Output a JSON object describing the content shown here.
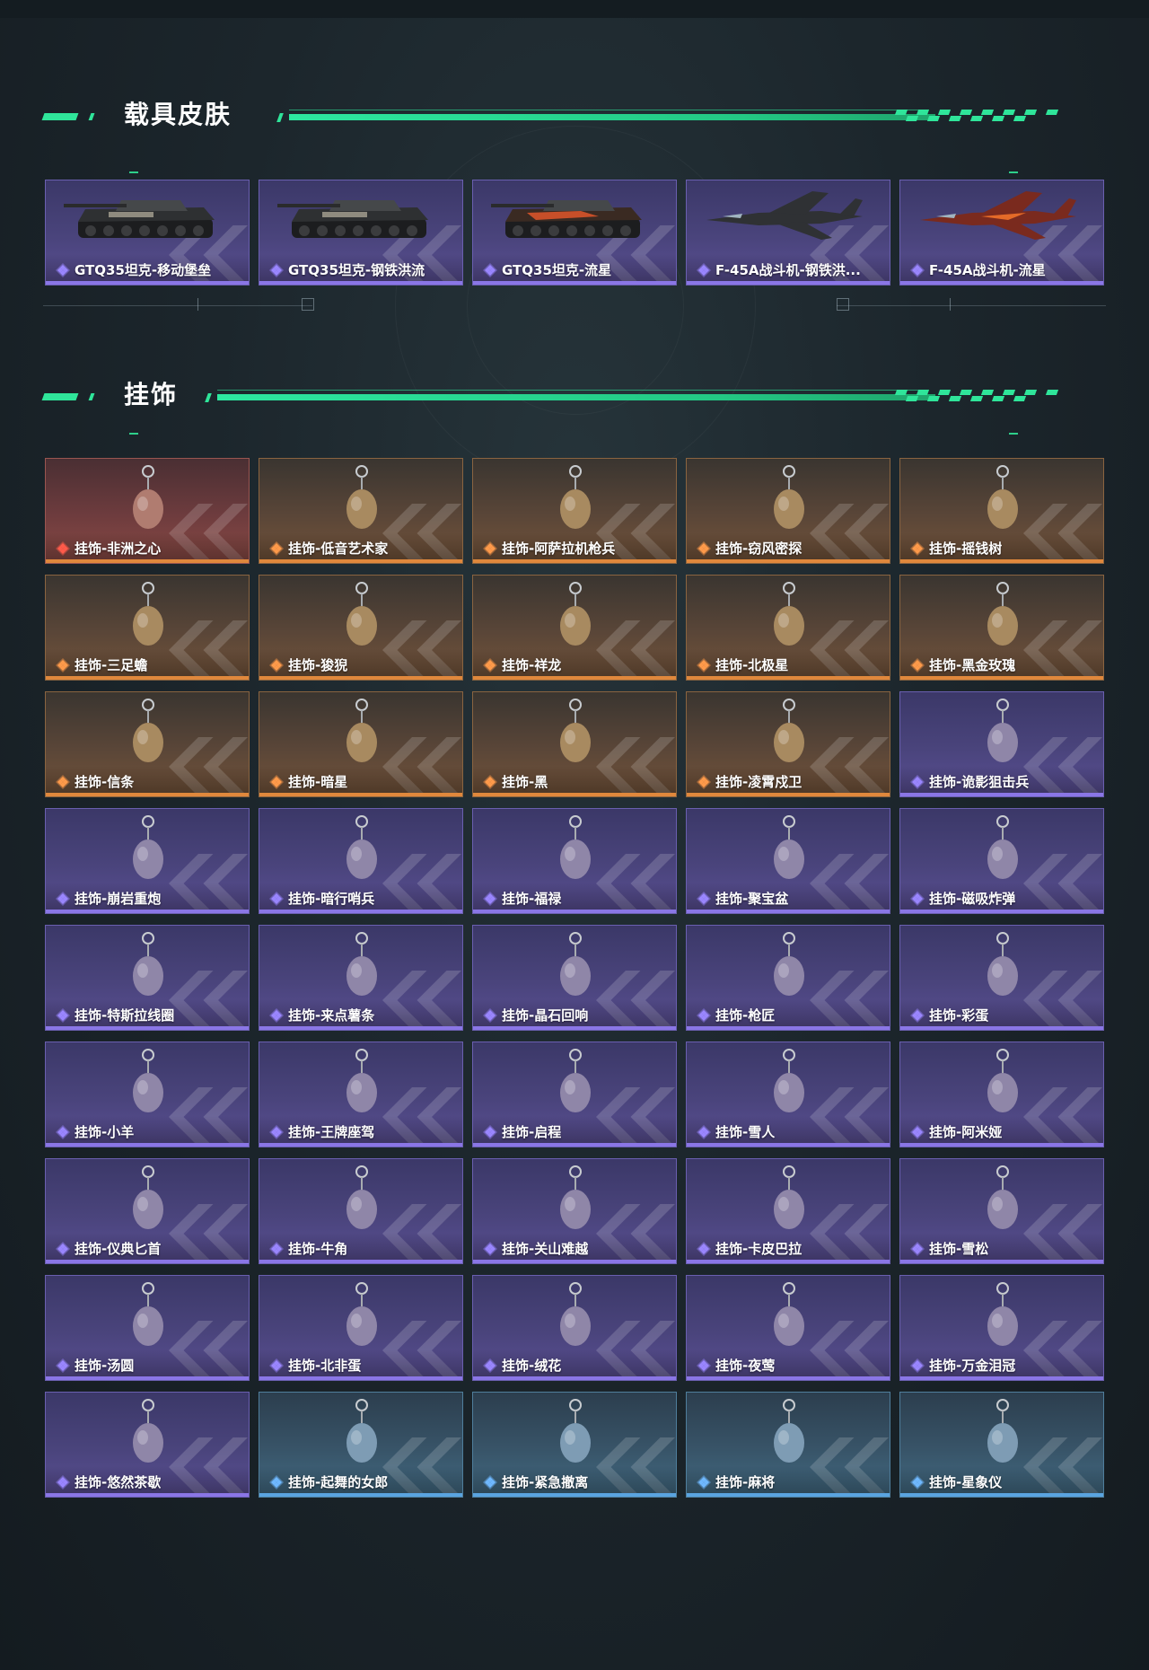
{
  "sections": [
    {
      "title": "载具皮肤"
    },
    {
      "title": "挂饰"
    }
  ],
  "colors": {
    "accent": "#2fe59a",
    "purple": "#8a76e6",
    "orange": "#e0883c",
    "blue": "#5aa4e0"
  },
  "vehicles": [
    {
      "label": "GTQ35坦克-移动堡垒",
      "rarity": "purple",
      "icon": "tank-icon"
    },
    {
      "label": "GTQ35坦克-钢铁洪流",
      "rarity": "purple",
      "icon": "tank-icon"
    },
    {
      "label": "GTQ35坦克-流星",
      "rarity": "purple",
      "icon": "tank-icon"
    },
    {
      "label": "F-45A战斗机-钢铁洪...",
      "rarity": "purple",
      "icon": "jet-icon"
    },
    {
      "label": "F-45A战斗机-流星",
      "rarity": "purple",
      "icon": "jet-icon"
    }
  ],
  "pendants": [
    {
      "label": "挂饰-非洲之心",
      "rarity": "red"
    },
    {
      "label": "挂饰-低音艺术家",
      "rarity": "orange"
    },
    {
      "label": "挂饰-阿萨拉机枪兵",
      "rarity": "orange"
    },
    {
      "label": "挂饰-窃风密探",
      "rarity": "orange"
    },
    {
      "label": "挂饰-摇钱树",
      "rarity": "orange"
    },
    {
      "label": "挂饰-三足蟾",
      "rarity": "orange"
    },
    {
      "label": "挂饰-狻猊",
      "rarity": "orange"
    },
    {
      "label": "挂饰-祥龙",
      "rarity": "orange"
    },
    {
      "label": "挂饰-北极星",
      "rarity": "orange"
    },
    {
      "label": "挂饰-黑金玫瑰",
      "rarity": "orange"
    },
    {
      "label": "挂饰-信条",
      "rarity": "orange"
    },
    {
      "label": "挂饰-暗星",
      "rarity": "orange"
    },
    {
      "label": "挂饰-黑",
      "rarity": "orange"
    },
    {
      "label": "挂饰-凌霄戍卫",
      "rarity": "orange"
    },
    {
      "label": "挂饰-诡影狙击兵",
      "rarity": "purple"
    },
    {
      "label": "挂饰-崩岩重炮",
      "rarity": "purple"
    },
    {
      "label": "挂饰-暗行哨兵",
      "rarity": "purple"
    },
    {
      "label": "挂饰-福禄",
      "rarity": "purple"
    },
    {
      "label": "挂饰-聚宝盆",
      "rarity": "purple"
    },
    {
      "label": "挂饰-磁吸炸弹",
      "rarity": "purple"
    },
    {
      "label": "挂饰-特斯拉线圈",
      "rarity": "purple"
    },
    {
      "label": "挂饰-来点薯条",
      "rarity": "purple"
    },
    {
      "label": "挂饰-晶石回响",
      "rarity": "purple"
    },
    {
      "label": "挂饰-枪匠",
      "rarity": "purple"
    },
    {
      "label": "挂饰-彩蛋",
      "rarity": "purple"
    },
    {
      "label": "挂饰-小羊",
      "rarity": "purple"
    },
    {
      "label": "挂饰-王牌座驾",
      "rarity": "purple"
    },
    {
      "label": "挂饰-启程",
      "rarity": "purple"
    },
    {
      "label": "挂饰-雪人",
      "rarity": "purple"
    },
    {
      "label": "挂饰-阿米娅",
      "rarity": "purple"
    },
    {
      "label": "挂饰-仪典匕首",
      "rarity": "purple"
    },
    {
      "label": "挂饰-牛角",
      "rarity": "purple"
    },
    {
      "label": "挂饰-关山难越",
      "rarity": "purple"
    },
    {
      "label": "挂饰-卡皮巴拉",
      "rarity": "purple"
    },
    {
      "label": "挂饰-雪松",
      "rarity": "purple"
    },
    {
      "label": "挂饰-汤圆",
      "rarity": "purple"
    },
    {
      "label": "挂饰-北非蛋",
      "rarity": "purple"
    },
    {
      "label": "挂饰-绒花",
      "rarity": "purple"
    },
    {
      "label": "挂饰-夜莺",
      "rarity": "purple"
    },
    {
      "label": "挂饰-万金泪冠",
      "rarity": "purple"
    },
    {
      "label": "挂饰-悠然茶歇",
      "rarity": "purple"
    },
    {
      "label": "挂饰-起舞的女郎",
      "rarity": "blue"
    },
    {
      "label": "挂饰-紧急撤离",
      "rarity": "blue"
    },
    {
      "label": "挂饰-麻将",
      "rarity": "blue"
    },
    {
      "label": "挂饰-星象仪",
      "rarity": "blue"
    }
  ]
}
